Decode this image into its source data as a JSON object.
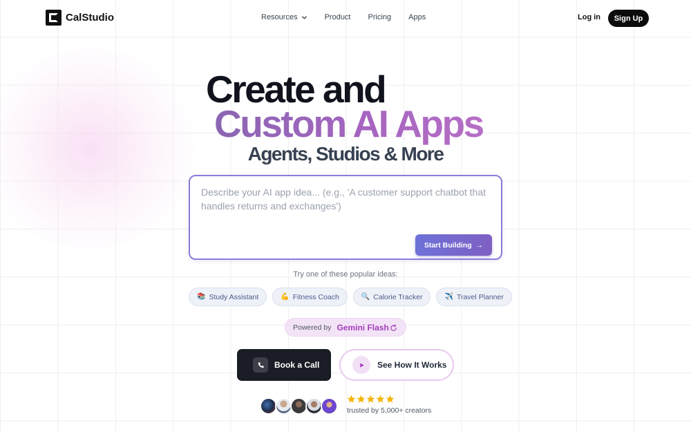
{
  "header": {
    "brand": "CalStudio",
    "nav": [
      {
        "label": "Resources",
        "has_dropdown": true
      },
      {
        "label": "Product"
      },
      {
        "label": "Pricing"
      },
      {
        "label": "Apps"
      }
    ],
    "login": "Log in",
    "signup": "Sign Up"
  },
  "hero": {
    "line1": "Create and",
    "line2": "Custom AI Apps",
    "line3": "Agents, Studios & More"
  },
  "prompt": {
    "placeholder": "Describe your AI app idea... (e.g., 'A customer support chatbot that handles returns and exchanges')",
    "value": "",
    "button": "Start Building",
    "button_arrow": "→"
  },
  "ideas": {
    "label": "Try one of these popular ideas:",
    "chips": [
      {
        "emoji": "📚",
        "label": "Study Assistant"
      },
      {
        "emoji": "💪",
        "label": "Fitness Coach"
      },
      {
        "emoji": "🔍",
        "label": "Calorie Tracker"
      },
      {
        "emoji": "✈️",
        "label": "Travel Planner"
      }
    ]
  },
  "powered": {
    "prefix": "Powered by",
    "model": "Gemini Flash"
  },
  "cta": {
    "book": "Book a Call",
    "watch": "See How It Works"
  },
  "social_proof": {
    "rating": 5,
    "text": "trusted by 5,000+ creators"
  },
  "colors": {
    "accent": "#8b7bd8",
    "gradient_text": "#a565c0",
    "model_text": "#a23fbd",
    "star": "#f5b50a"
  }
}
